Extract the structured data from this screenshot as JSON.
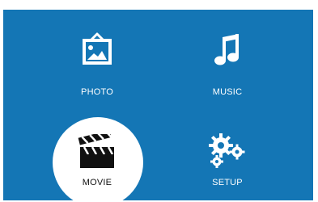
{
  "menu": {
    "items": [
      {
        "label": "PHOTO",
        "icon": "photo-frame-icon",
        "selected": false
      },
      {
        "label": "MUSIC",
        "icon": "music-note-icon",
        "selected": false
      },
      {
        "label": "MOVIE",
        "icon": "clapperboard-icon",
        "selected": true
      },
      {
        "label": "SETUP",
        "icon": "gears-icon",
        "selected": false
      }
    ]
  },
  "colors": {
    "background": "#1476b5",
    "selected_highlight": "#ffffff",
    "label_text": "#ffffff",
    "selected_label_text": "#111111"
  }
}
